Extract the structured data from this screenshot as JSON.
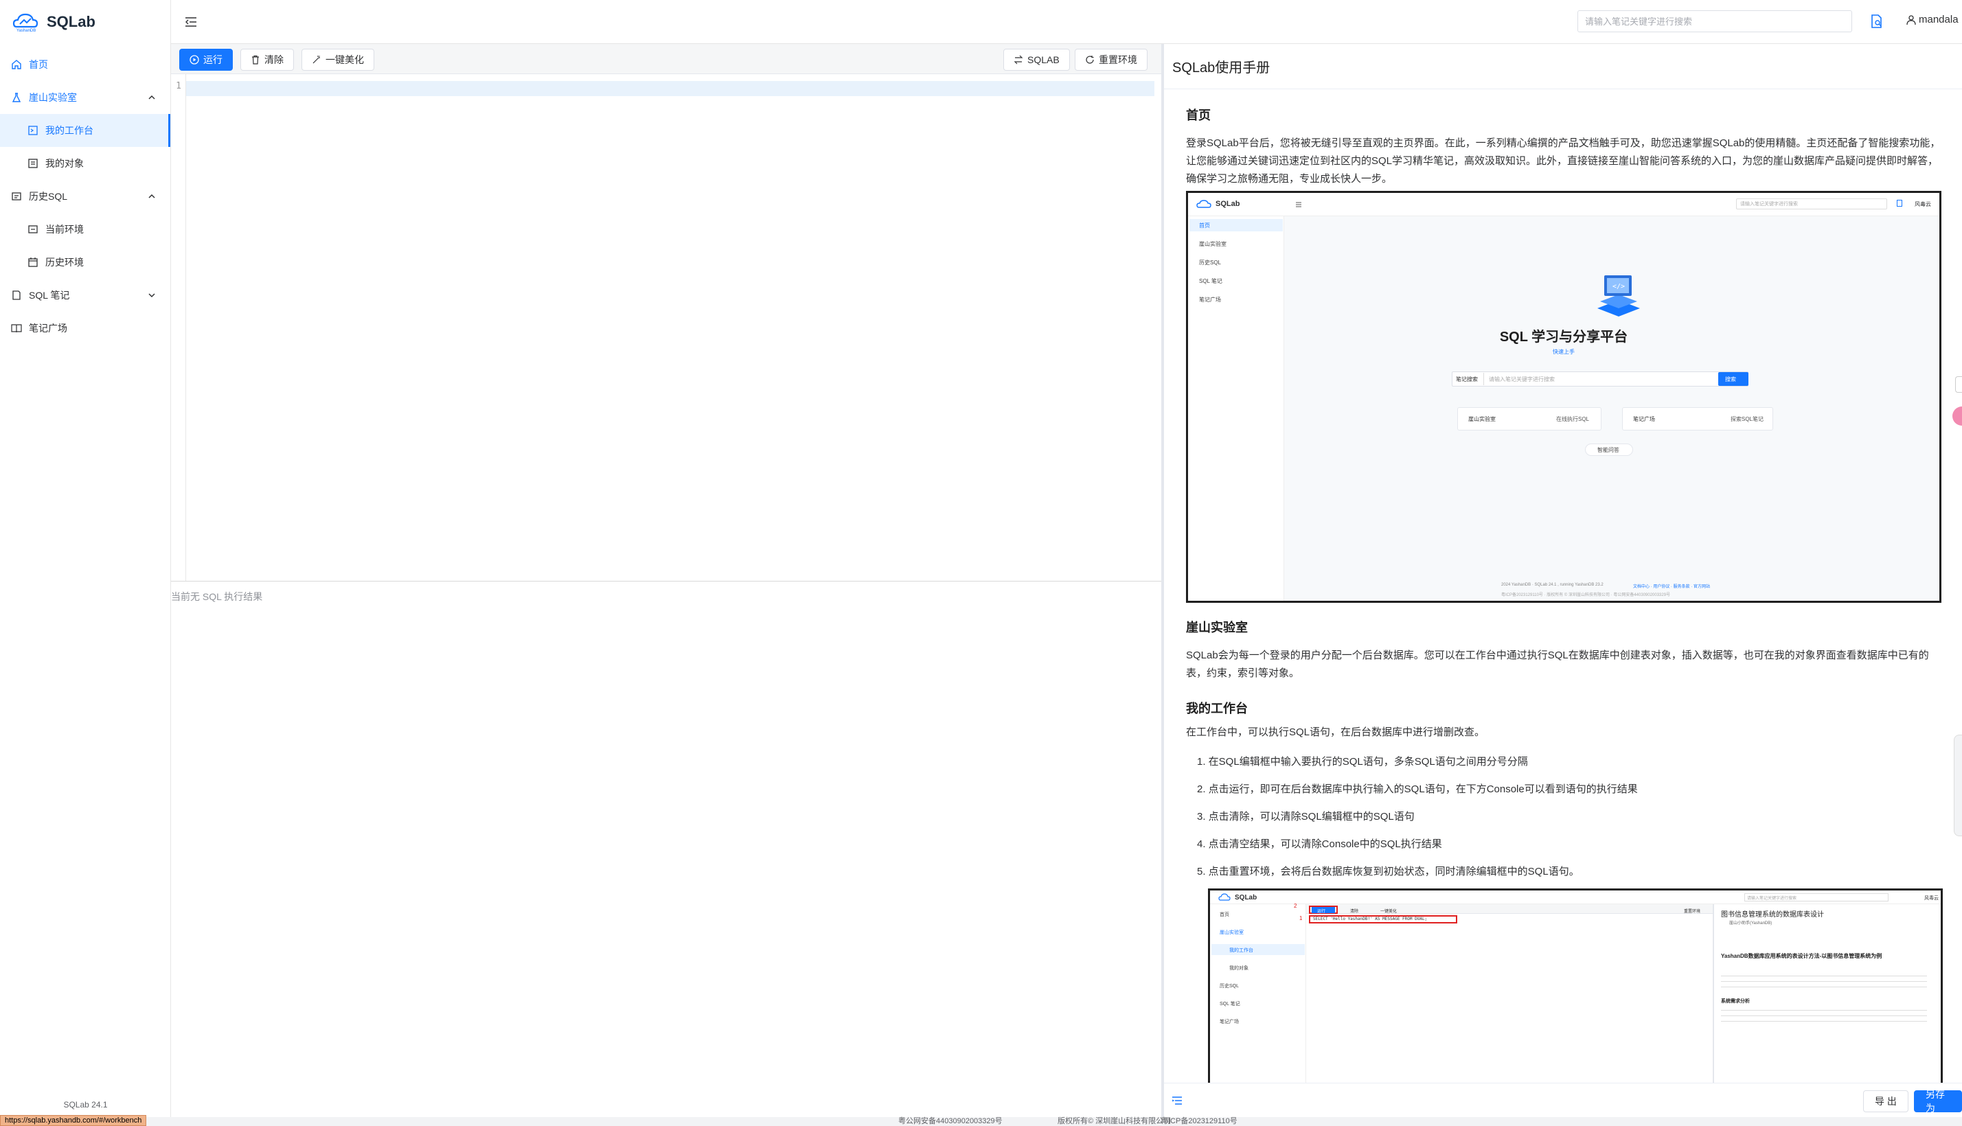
{
  "app": {
    "title": "SQLab",
    "version": "SQLab 24.1"
  },
  "sidebar": {
    "items": [
      {
        "label": "首页"
      },
      {
        "label": "崖山实验室"
      },
      {
        "label": "我的工作台"
      },
      {
        "label": "我的对象"
      },
      {
        "label": "历史SQL"
      },
      {
        "label": "当前环境"
      },
      {
        "label": "历史环境"
      },
      {
        "label": "SQL 笔记"
      },
      {
        "label": "笔记广场"
      }
    ]
  },
  "topbar": {
    "search_placeholder": "请输入笔记关键字进行搜索",
    "user": "mandala"
  },
  "toolbar": {
    "run": "运行",
    "clear": "清除",
    "beautify": "一键美化",
    "sqlab": "SQLAB",
    "reset": "重置环境"
  },
  "editor": {
    "line_number": "1"
  },
  "console": {
    "empty": "当前无 SQL 执行结果"
  },
  "panel": {
    "title": "SQLab使用手册",
    "section_home": "首页",
    "home_text": "登录SQLab平台后，您将被无缝引导至直观的主页界面。在此，一系列精心编撰的产品文档触手可及，助您迅速掌握SQLab的使用精髓。主页还配备了智能搜索功能，让您能够通过关键词迅速定位到社区内的SQL学习精华笔记，高效汲取知识。此外，直接链接至崖山智能问答系统的入口，为您的崖山数据库产品疑问提供即时解答，确保学习之旅畅通无阻，专业成长快人一步。",
    "section_lab": "崖山实验室",
    "lab_text": "SQLab会为每一个登录的用户分配一个后台数据库。您可以在工作台中通过执行SQL在数据库中创建表对象，插入数据等，也可在我的对象界面查看数据库中已有的表，约束，索引等对象。",
    "section_workbench": "我的工作台",
    "workbench_text": "在工作台中，可以执行SQL语句，在后台数据库中进行增删改查。",
    "steps": [
      "1. 在SQL编辑框中输入要执行的SQL语句，多条SQL语句之间用分号分隔",
      "2. 点击运行，即可在后台数据库中执行输入的SQL语句，在下方Console可以看到语句的执行结果",
      "3. 点击清除，可以清除SQL编辑框中的SQL语句",
      "4. 点击清空结果，可以清除Console中的SQL执行结果",
      "5. 点击重置环境，会将后台数据库恢复到初始状态，同时清除编辑框中的SQL语句。"
    ],
    "export": "导 出",
    "save_as": "另存为"
  },
  "shot1": {
    "brand": "SQLab",
    "menu": [
      "首页",
      "崖山实验室",
      "历史SQL",
      "SQL 笔记",
      "笔记广场"
    ],
    "search_placeholder": "请输入笔记关键字进行搜索",
    "user": "风毒云",
    "hero": "SQL 学习与分享平台",
    "hero_link": "快速上手",
    "search_label": "笔记搜索",
    "search_box": "请输入笔记关键字进行搜索",
    "search_btn": "搜索",
    "card1_left": "崖山实验室",
    "card1_right": "在线执行SQL",
    "card2_left": "笔记广场",
    "card2_right": "探索SQL笔记",
    "qa": "智能问答",
    "footer1": "2024 YashanDB · SQLab 24.1 , running YashanDB 23.2",
    "footer1_links": "文档中心 · 用户协议 · 服务条款 · 官方网站",
    "footer2": "粤ICP备2023129110号 · 版权所有 © 深圳崖山科技有限公司 · 粤公网安备44030902003329号"
  },
  "shot2": {
    "brand": "SQLab",
    "menu": [
      "首页",
      "崖山实验室",
      "我的工作台",
      "我的对象",
      "历史SQL",
      "SQL 笔记",
      "笔记广场"
    ],
    "run": "运行",
    "clear": "清除",
    "beautify": "一键美化",
    "reset": "重置环境",
    "code": "SELECT 'Hello YashanDB!' AS MESSAGE FROM DUAL;",
    "mark2": "2",
    "mark1": "1",
    "doc_title": "图书信息管理系统的数据库表设计",
    "doc_author": "崖山小助手(YashanDB)",
    "doc_subtitle": "YashanDB数据库应用系统的表设计方法-以图书信息管理系统为例",
    "doc_section": "系统需求分析",
    "search_placeholder": "请输入笔记关键字进行搜索",
    "user": "风毒云"
  },
  "footer": {
    "beian": "粤公网安备44030902003329号",
    "copyright": "版权所有© 深圳崖山科技有限公司",
    "icp": "粤ICP备2023129110号",
    "url": "https://sqlab.yashandb.com/#/workbench"
  }
}
